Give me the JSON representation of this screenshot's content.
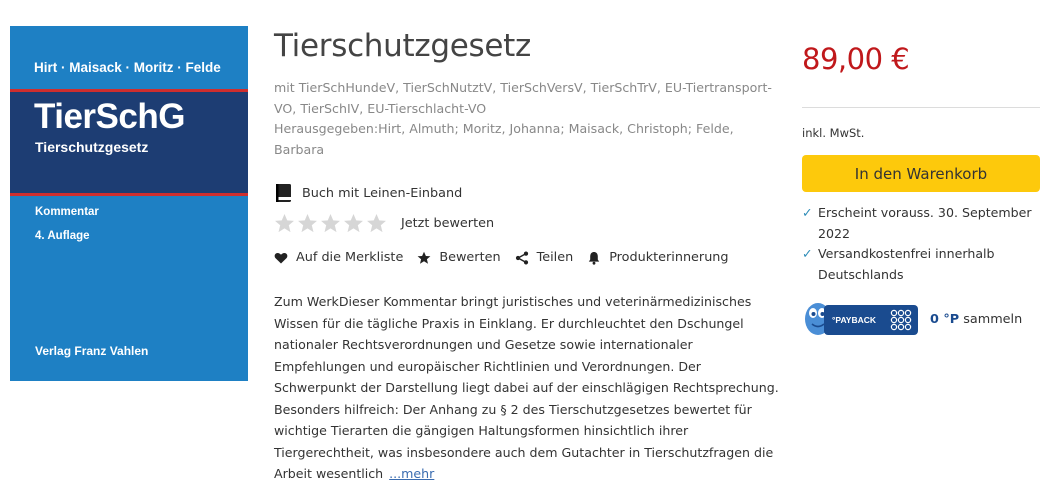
{
  "cover": {
    "authors": "Hirt · Maisack · Moritz · Felde",
    "abbreviation": "TierSchG",
    "subtitle": "Tierschutzgesetz",
    "type": "Kommentar",
    "edition": "4. Auflage",
    "publisher": "Verlag Franz Vahlen"
  },
  "product": {
    "title": "Tierschutzgesetz",
    "meta_lines": [
      "mit TierSchHundeV, TierSchNutztV, TierSchVersV, TierSchTrV, EU-Tiertransport-",
      "VO, TierSchIV, EU-Tierschlacht-VO",
      "Herausgegeben:Hirt, Almuth; Moritz, Johanna; Maisack, Christoph; Felde,",
      "Barbara"
    ],
    "format": "Buch mit Leinen-Einband",
    "rating_label": "Jetzt bewerten",
    "rating_value": 0,
    "rating_max": 5
  },
  "actions": [
    {
      "label": "Auf die Merkliste",
      "icon": "heart-icon"
    },
    {
      "label": "Bewerten",
      "icon": "star-icon"
    },
    {
      "label": "Teilen",
      "icon": "share-icon"
    },
    {
      "label": "Produkterinnerung",
      "icon": "bell-icon"
    }
  ],
  "description": {
    "lines": [
      "Zum WerkDieser Kommentar bringt juristisches und veterinärmedizinisches",
      "Wissen für die tägliche Praxis in Einklang. Er durchleuchtet den Dschungel",
      "nationaler Rechtsverordnungen und Gesetze sowie internationaler",
      "Empfehlungen und europäischer Richtlinien und Verordnungen. Der",
      "Schwerpunkt der Darstellung liegt dabei auf der einschlägigen Rechtsprechung.",
      "Besonders hilfreich: Der Anhang zu § 2 des Tierschutzgesetzes bewertet für",
      "wichtige Tierarten die gängigen Haltungsformen hinsichtlich ihrer",
      "Tiergerechtheit, was insbesondere auch dem Gutachter in Tierschutzfragen die",
      "Arbeit wesentlich"
    ],
    "more_label": "...mehr"
  },
  "purchase": {
    "price": "89,00 €",
    "tax_note": "inkl. MwSt.",
    "cart_button": "In den Warenkorb",
    "checks": [
      {
        "lines": [
          "Erscheint vorauss. 30. September",
          "2022"
        ]
      },
      {
        "lines": [
          "Versandkostenfrei innerhalb",
          "Deutschlands"
        ]
      }
    ],
    "check_mark": "✓",
    "payback_brand": "°PAYBACK",
    "points_value": "0 °P",
    "points_label": "sammeln"
  },
  "colors": {
    "price": "#c0181b",
    "cart_button": "#fdc90c",
    "check": "#2d8cb8",
    "cover_blue": "#1e80c4",
    "cover_band": "#1d3d73",
    "cover_stripe": "#cf2e2e",
    "payback": "#1a4b8f",
    "star_empty": "#d6d6d6",
    "link": "#3a6cb0"
  }
}
